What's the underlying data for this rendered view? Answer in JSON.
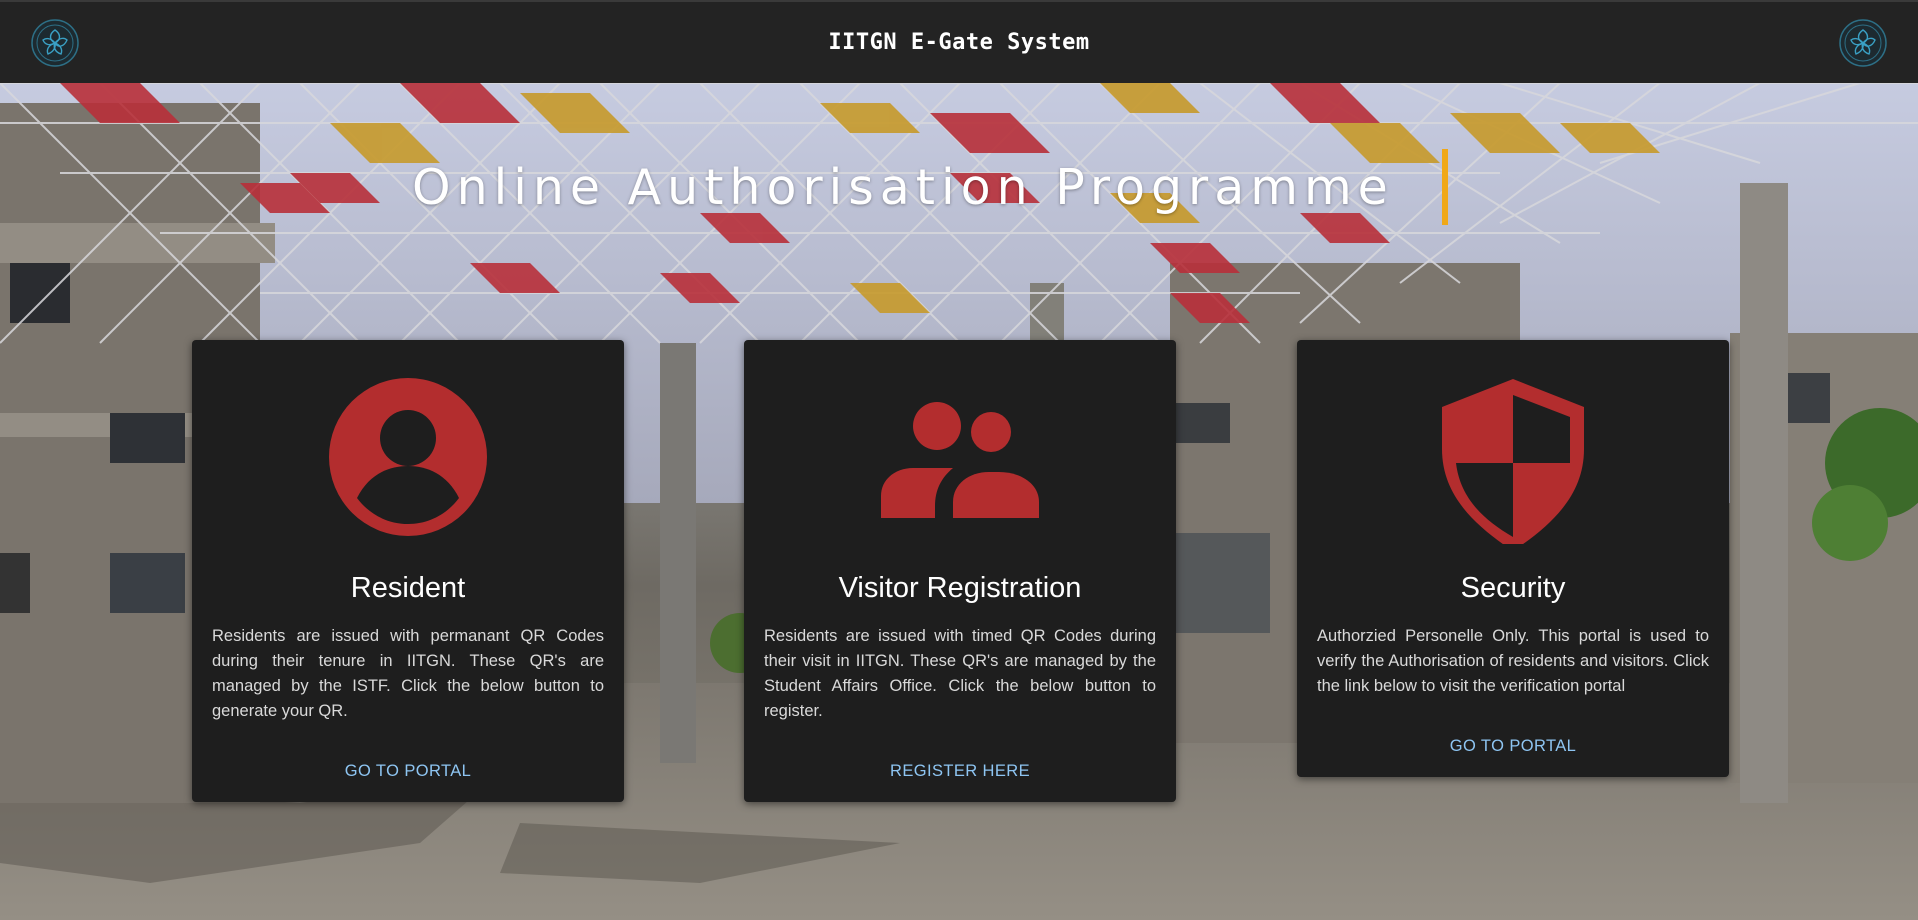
{
  "header": {
    "title": "IITGN E-Gate System"
  },
  "hero": {
    "headline": "Online Authorisation Programme"
  },
  "cards": [
    {
      "title": "Resident",
      "description": "Residents are issued with permanant QR Codes during their tenure in IITGN. These QR's are managed by the ISTF. Click the below button to generate your QR.",
      "link": "GO TO PORTAL",
      "icon": "user-circle-icon"
    },
    {
      "title": "Visitor Registration",
      "description": "Residents are issued with timed QR Codes during their visit in IITGN. These QR's are managed by the Student Affairs Office. Click the below button to register.",
      "link": "REGISTER HERE",
      "icon": "group-icon"
    },
    {
      "title": "Security",
      "description": "Authorzied Personelle Only. This portal is used to verify the Authorisation of residents and visitors. Click the link below to visit the verification portal",
      "link": "GO TO PORTAL",
      "icon": "shield-icon"
    }
  ],
  "colors": {
    "icon_red": "#b32d2e",
    "link_blue": "#8ec5f2",
    "caret_orange": "#f0a818",
    "card_bg": "#1e1e1e",
    "topbar_bg": "#232323"
  }
}
